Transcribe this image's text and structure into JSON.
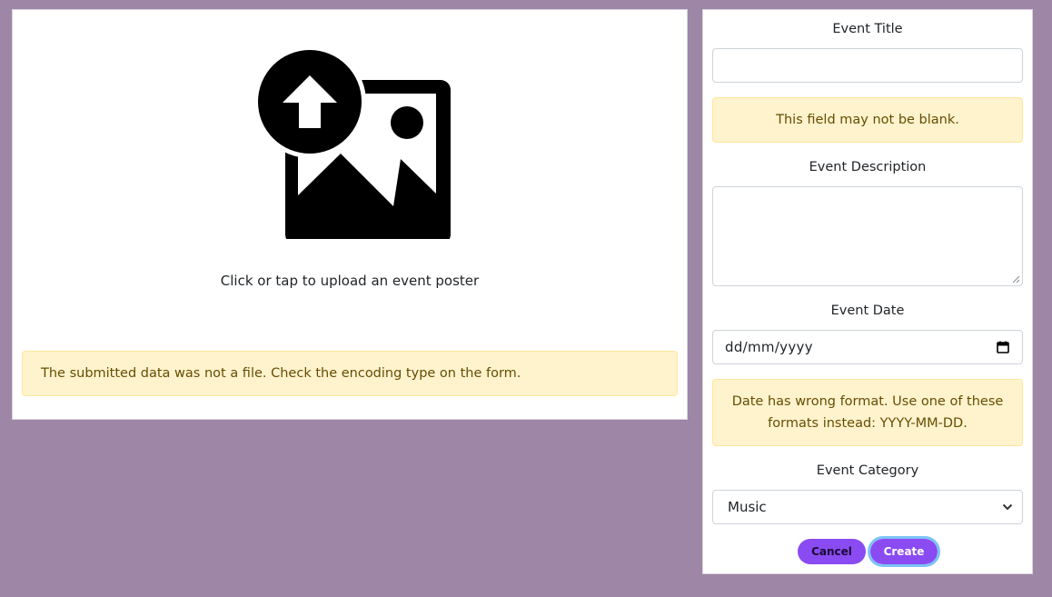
{
  "upload": {
    "prompt": "Click or tap to upload an event poster",
    "icon": "add-photo-icon",
    "error": "The submitted data was not a file. Check the encoding type on the form."
  },
  "form": {
    "title_label": "Event Title",
    "title_value": "",
    "title_error": "This field may not be blank.",
    "description_label": "Event Description",
    "description_value": "",
    "date_label": "Event Date",
    "date_placeholder": "dd/mm/yyyy",
    "date_error": "Date has wrong format. Use one of these formats instead: YYYY-MM-DD.",
    "category_label": "Event Category",
    "category_value": "Music"
  },
  "buttons": {
    "cancel": "Cancel",
    "create": "Create"
  },
  "colors": {
    "background": "#9d86a6",
    "accent": "#8a4bf2",
    "alert_bg": "#fff3cd",
    "alert_text": "#664d03",
    "focus_ring": "#7cc3f5"
  }
}
